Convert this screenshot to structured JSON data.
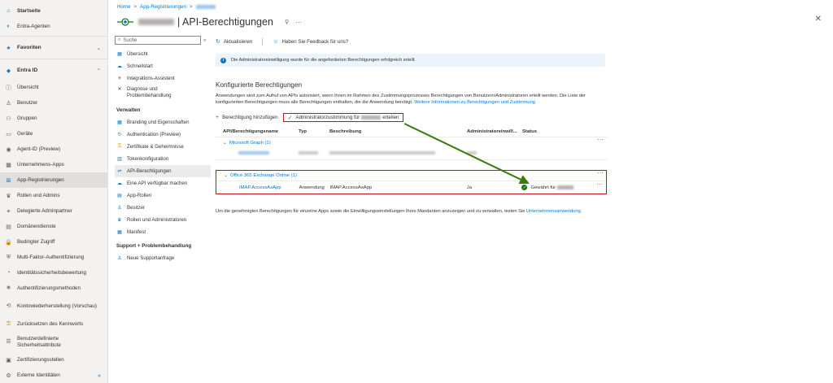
{
  "leftnav": {
    "items_top": [
      {
        "label": "Startseite",
        "icon": "home-icon",
        "bold": true
      },
      {
        "label": "Entra-Agenten",
        "icon": "agent-icon",
        "bold": false
      }
    ],
    "favorites_label": "Favoriten",
    "entra_label": "Entra ID",
    "items": [
      {
        "label": "Übersicht",
        "icon": "info-icon"
      },
      {
        "label": "Benutzer",
        "icon": "user-icon"
      },
      {
        "label": "Gruppen",
        "icon": "group-icon"
      },
      {
        "label": "Geräte",
        "icon": "device-icon"
      },
      {
        "label": "Agent-ID (Preview)",
        "icon": "agent-id-icon"
      },
      {
        "label": "Unternehmens-Apps",
        "icon": "enterprise-apps-icon"
      },
      {
        "label": "App-Registrierungen",
        "icon": "app-registrations-icon",
        "active": true
      },
      {
        "label": "Rollen und Admins",
        "icon": "roles-icon"
      },
      {
        "label": "Delegierte Adminpartner",
        "icon": "partner-icon"
      },
      {
        "label": "Domänendienste",
        "icon": "domain-icon"
      },
      {
        "label": "Bedingter Zugriff",
        "icon": "lock-icon"
      },
      {
        "label": "Multi-Faktor-Authentifizierung",
        "icon": "mfa-icon"
      },
      {
        "label": "Identitätssicherheitsbewertung",
        "icon": "score-icon"
      },
      {
        "label": "Authentifizierungsmethoden",
        "icon": "auth-methods-icon"
      },
      {
        "label": "Kontowiederherstellung (Vorschau)",
        "icon": "recovery-icon",
        "multi": true
      },
      {
        "label": "Zurücksetzen des Kennworts",
        "icon": "key-icon"
      },
      {
        "label": "Benutzerdefinierte Sicherheitsattribute",
        "icon": "attributes-icon",
        "multi": true
      },
      {
        "label": "Zertifizierungsstellen",
        "icon": "certificate-icon"
      },
      {
        "label": "Externe Identitäten",
        "icon": "external-icon"
      }
    ],
    "collapse_glyph": "«"
  },
  "breadcrumb": {
    "home": "Home",
    "sep": ">",
    "app_reg": "App-Registrierungen"
  },
  "header": {
    "title": "| API-Berechtigungen",
    "pin": "⚲",
    "more": "···",
    "close": "✕"
  },
  "resmenu": {
    "search_placeholder": "Suche",
    "collapse": "«",
    "items_top": [
      {
        "label": "Übersicht",
        "icon": "overview-icon"
      },
      {
        "label": "Schnellstart",
        "icon": "quickstart-icon"
      },
      {
        "label": "Integrations-Assistent",
        "icon": "rocket-icon"
      },
      {
        "label": "Diagnose und Problembehandlung",
        "icon": "wrench-icon",
        "multi": true
      }
    ],
    "section_manage": "Verwalten",
    "items_manage": [
      {
        "label": "Branding und Eigenschaften",
        "icon": "branding-icon"
      },
      {
        "label": "Authentication (Preview)",
        "icon": "authentication-icon"
      },
      {
        "label": "Zertifikate & Geheimnisse",
        "icon": "key-icon"
      },
      {
        "label": "Tokenkonfiguration",
        "icon": "token-icon"
      },
      {
        "label": "API-Berechtigungen",
        "icon": "api-permissions-icon",
        "active": true
      },
      {
        "label": "Eine API verfügbar machen",
        "icon": "cloud-icon"
      },
      {
        "label": "App-Rollen",
        "icon": "app-roles-icon"
      },
      {
        "label": "Besitzer",
        "icon": "owner-icon"
      },
      {
        "label": "Rollen und Administratoren",
        "icon": "roles-admins-icon"
      },
      {
        "label": "Manifest",
        "icon": "manifest-icon"
      }
    ],
    "section_support": "Support + Problembehandlung",
    "items_support": [
      {
        "label": "Neue Supportanfrage",
        "icon": "support-icon"
      }
    ]
  },
  "toolbar": {
    "refresh": "Aktualisieren",
    "feedback": "Haben Sie Feedback für uns?"
  },
  "infobar": {
    "text": "Die Administratoreinwilligung wurde für die angeforderten Berechtigungen erfolgreich erteilt."
  },
  "configured": {
    "title": "Konfigurierte Berechtigungen",
    "desc": "Anwendungen sind zum Aufruf von APIs autorisiert, wenn ihnen im Rahmen des Zustimmungsprozesses Berechtigungen von Benutzern/Administratoren erteilt werden. Die Liste der konfigurierten Berechtigungen muss alle Berechtigungen enthalten, die die Anwendung benötigt.",
    "link": "Weitere Informationen zu Berechtigungen und Zustimmung"
  },
  "actions": {
    "add": "Berechtigung hinzufügen",
    "grant_prefix": "Administratorzustimmung für",
    "grant_suffix": "erteilen"
  },
  "table": {
    "headers": [
      "API/Berechtigungsname",
      "Typ",
      "Beschreibung",
      "Administratoreinwill...",
      "Status"
    ],
    "group1": "Microsoft Graph (1)",
    "group2": "Office 365 Exchange Online (1)",
    "row2": {
      "name": "IMAP.AccessAsApp",
      "type": "Anwendung",
      "desc": "IMAP.AccessAsApp",
      "admin": "Ja",
      "status": "Gewährt für"
    },
    "more": "···"
  },
  "footer": {
    "text": "Um die genehmigten Berechtigungen für einzelne Apps sowie die Einwilligungseinstellungen Ihres Mandanten anzuzeigen und zu verwalten, testen Sie",
    "link": "Unternehmensanwendung."
  },
  "colors": {
    "accent": "#0078d4",
    "highlight": "#c50f1f",
    "arrow": "#3a7a0b",
    "success": "#107c10"
  }
}
